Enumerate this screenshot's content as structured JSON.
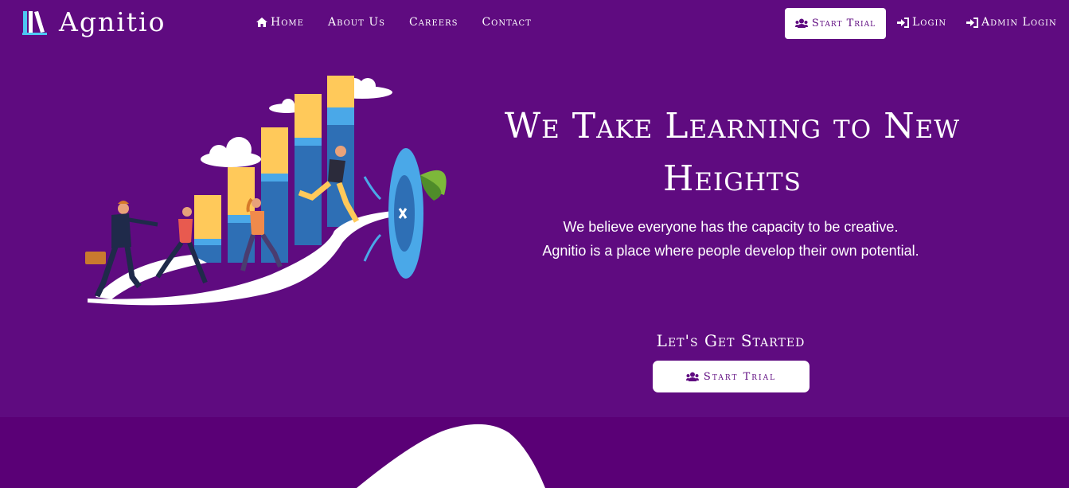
{
  "brand": {
    "name": "Agnitio"
  },
  "nav": {
    "links": [
      {
        "label": "Home",
        "icon": "home-icon"
      },
      {
        "label": "About Us"
      },
      {
        "label": "Careers"
      },
      {
        "label": "Contact"
      }
    ],
    "start_trial": "Start Trial",
    "login": "Login",
    "admin_login": "Admin Login"
  },
  "hero": {
    "title": "We Take Learning to New Heights",
    "line1": "We believe everyone has the capacity to be creative.",
    "line2": "Agnitio is a place where people develop their own potential.",
    "cta_heading": "Let's Get Started",
    "cta_button": "Start Trial"
  },
  "colors": {
    "background": "#5f0b80",
    "bottom_band": "#5a0076",
    "button_bg": "#ffffff",
    "button_text": "#5f0b80"
  }
}
